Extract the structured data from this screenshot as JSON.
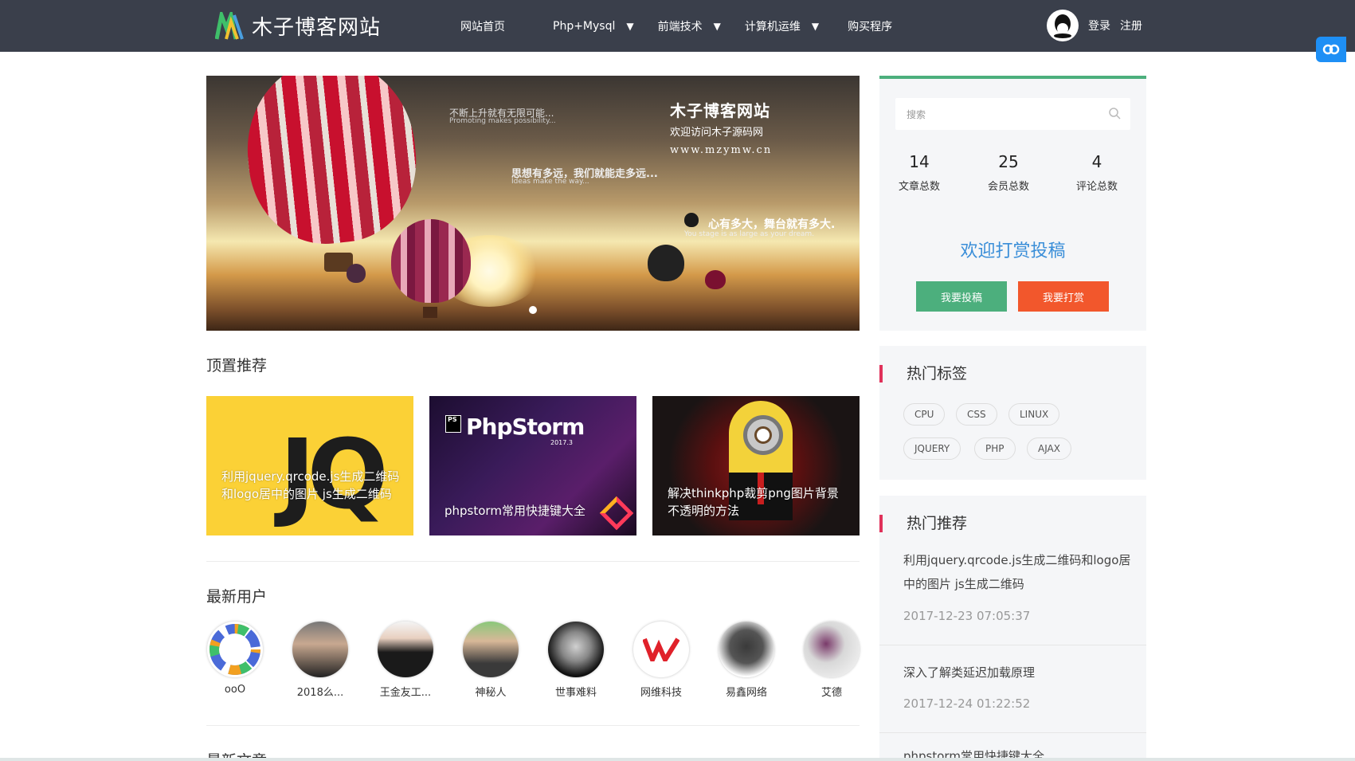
{
  "header": {
    "logo_text": "木子博客网站",
    "nav": [
      {
        "label": "网站首页",
        "has_dropdown": false
      },
      {
        "label": "Php+Mysql",
        "has_dropdown": true
      },
      {
        "label": "前端技术",
        "has_dropdown": true
      },
      {
        "label": "计算机运维",
        "has_dropdown": true
      },
      {
        "label": "购买程序",
        "has_dropdown": false
      }
    ],
    "dropdown_glyph": "▼",
    "login_label": "登录",
    "register_label": "注册"
  },
  "banner": {
    "title": "木子博客网站",
    "subtitle": "欢迎访问木子源码网",
    "url": "www.mzymw.cn",
    "text1": "不断上升就有无限可能...",
    "text1_en": "Promoting makes possibility...",
    "text2": "思想有多远，我们就能走多远...",
    "text2_en": "Ideas make the way...",
    "text3": "心有多大，舞台就有多大.",
    "text3_en": "You stage is as large as your dream."
  },
  "top_recommend": {
    "title": "顶置推荐",
    "cards": [
      {
        "caption": "利用jquery.qrcode.js生成二维码和logo居中的图片 js生成二维码",
        "art_text": "JQ"
      },
      {
        "caption": "phpstorm常用快捷键大全",
        "art_text": "PhpStorm",
        "art_version": "2017.3",
        "art_badge": "PS"
      },
      {
        "caption": "解决thinkphp裁剪png图片背景不透明的方法"
      }
    ]
  },
  "latest_users": {
    "title": "最新用户",
    "users": [
      {
        "name": "ooO"
      },
      {
        "name": "2018么..."
      },
      {
        "name": "王金友工..."
      },
      {
        "name": "神秘人"
      },
      {
        "name": "世事难料"
      },
      {
        "name": "网维科技"
      },
      {
        "name": "易鑫网络"
      },
      {
        "name": "艾德"
      }
    ]
  },
  "latest_articles": {
    "title": "最新文章"
  },
  "sidebar": {
    "search_placeholder": "搜索",
    "stats": [
      {
        "value": "14",
        "label": "文章总数"
      },
      {
        "value": "25",
        "label": "会员总数"
      },
      {
        "value": "4",
        "label": "评论总数"
      }
    ],
    "welcome": "欢迎打赏投稿",
    "submit_label": "我要投稿",
    "donate_label": "我要打赏",
    "hot_tags_title": "热门标签",
    "tags": [
      "CPU",
      "CSS",
      "LINUX",
      "JQUERY",
      "PHP",
      "AJAX"
    ],
    "hot_recommend_title": "热门推荐",
    "recommend": [
      {
        "title": "利用jquery.qrcode.js生成二维码和logo居中的图片 js生成二维码",
        "date": "2017-12-23 07:05:37"
      },
      {
        "title": "深入了解类延迟加载原理",
        "date": "2017-12-24 01:22:52"
      },
      {
        "title": "phpstorm常用快捷键大全"
      }
    ]
  },
  "colors": {
    "header_bg": "#3a3f4b",
    "accent_green": "#4caf7d",
    "accent_orange": "#f2572c",
    "accent_blue": "#3a8ed8",
    "accent_red": "#e0315a"
  }
}
